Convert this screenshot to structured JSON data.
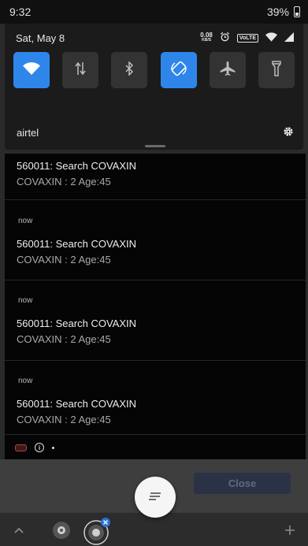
{
  "status_bar": {
    "time": "9:32",
    "battery": "39%"
  },
  "quick_settings": {
    "date": "Sat, May 8",
    "net_speed_value": "0.08",
    "net_speed_unit": "KB/S",
    "volte_label": "VoLTE",
    "carrier": "airtel",
    "tiles": [
      {
        "icon": "wifi-icon",
        "active": true
      },
      {
        "icon": "mobile-data-icon",
        "active": false
      },
      {
        "icon": "bluetooth-icon",
        "active": false
      },
      {
        "icon": "auto-rotate-icon",
        "active": true
      },
      {
        "icon": "airplane-mode-icon",
        "active": false
      },
      {
        "icon": "flashlight-icon",
        "active": false
      }
    ],
    "colors": {
      "active_tile": "#2f86ea",
      "inactive_tile": "#333333"
    }
  },
  "notifications": [
    {
      "time": "",
      "title": "560011: Search COVAXIN",
      "text": "COVAXIN : 2 Age:45"
    },
    {
      "time": "now",
      "title": "560011: Search COVAXIN",
      "text": "COVAXIN : 2 Age:45"
    },
    {
      "time": "now",
      "title": "560011: Search COVAXIN",
      "text": "COVAXIN : 2 Age:45"
    },
    {
      "time": "now",
      "title": "560011: Search COVAXIN",
      "text": "COVAXIN : 2 Age:45"
    }
  ],
  "app": {
    "close_label": "Close"
  }
}
